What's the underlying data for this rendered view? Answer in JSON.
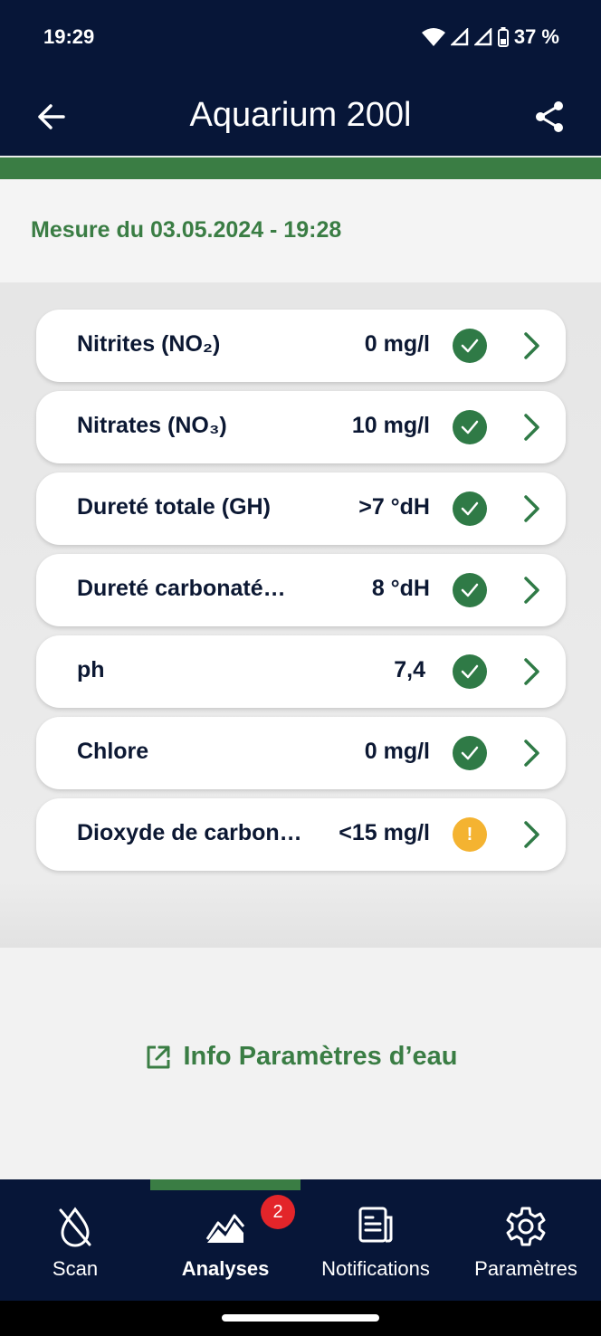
{
  "status_bar": {
    "time": "19:29",
    "battery": "37 %"
  },
  "app_bar": {
    "title": "Aquarium 200l"
  },
  "measurement": {
    "label": "Mesure du 03.05.2024 - 19:28"
  },
  "parameters": [
    {
      "label": "Nitrites (NO₂)",
      "value": "0 mg/l",
      "status": "ok"
    },
    {
      "label": "Nitrates (NO₃)",
      "value": "10 mg/l",
      "status": "ok"
    },
    {
      "label": "Dureté totale (GH)",
      "value": ">7 °dH",
      "status": "ok"
    },
    {
      "label": "Dureté carbonaté…",
      "value": "8 °dH",
      "status": "ok"
    },
    {
      "label": "ph",
      "value": "7,4",
      "status": "ok"
    },
    {
      "label": "Chlore",
      "value": "0 mg/l",
      "status": "ok"
    },
    {
      "label": "Dioxyde de carbon…",
      "value": "<15 mg/l",
      "status": "warning",
      "status_symbol": "!"
    }
  ],
  "info_link": {
    "label": "Info Paramètres d’eau"
  },
  "bottom_nav": {
    "items": [
      {
        "label": "Scan",
        "icon": "drop-slash-icon"
      },
      {
        "label": "Analyses",
        "icon": "chart-area-icon",
        "active": true
      },
      {
        "label": "Notifications",
        "icon": "document-list-icon",
        "badge": "2"
      },
      {
        "label": "Paramètres",
        "icon": "gear-icon"
      }
    ]
  },
  "colors": {
    "navy": "#071638",
    "green": "#3a7d44",
    "ok": "#2f7a46",
    "warning": "#f4b331",
    "badge": "#e3252a"
  }
}
